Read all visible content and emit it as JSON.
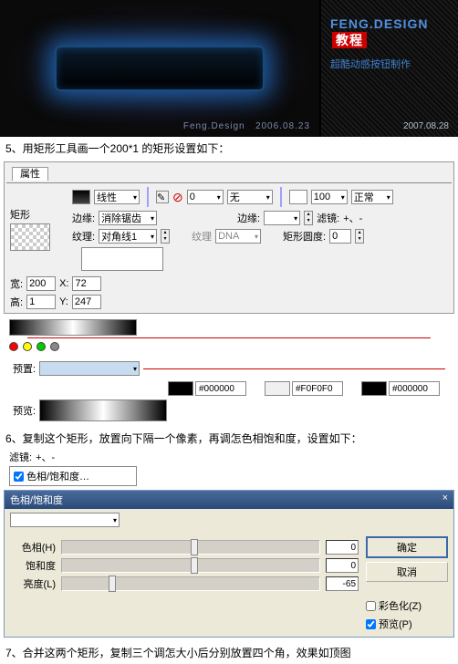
{
  "banner": {
    "logo_en": "FENG.DESIGN",
    "logo_cn": "教程",
    "subtitle": "超酷动感按钮制作",
    "footer_left": "Feng.Design",
    "date_left": "2006.08.23",
    "date_right": "2007.08.28"
  },
  "step5": "5、用矩形工具画一个200*1 的矩形设置如下：",
  "step6": "6、复制这个矩形，放置向下隔一个像素，再调怎色相饱和度，设置如下：",
  "step7": "7、合并这两个矩形，复制三个调怎大小后分别放置四个角，效果如顶图",
  "props": {
    "tab": "属性",
    "shape_lbl": "矩形",
    "stroke_type": "线性",
    "edge_lbl": "边缘:",
    "edge_val": "消除锯齿",
    "texture_lbl": "纹理:",
    "texture_val": "对角线1",
    "texture_dna": "DNA",
    "width_lbl": "宽:",
    "width_val": "200",
    "height_lbl": "高:",
    "height_val": "1",
    "x_lbl": "X:",
    "x_val": "72",
    "y_lbl": "Y:",
    "y_val": "247",
    "fill_none": "无",
    "edge2_lbl": "边缘:",
    "normal": "正常",
    "hundred": "100",
    "zero": "0",
    "filter_lbl": "滤镜:",
    "filter_plus": "+、-",
    "radius_lbl": "矩形圆度:",
    "preset_lbl": "预置:",
    "preview_lbl": "预览:",
    "texture2_lbl": "纹理"
  },
  "hexes": {
    "h1": "#000000",
    "h2": "#F0F0F0",
    "h3": "#000000"
  },
  "filter": {
    "label": "滤镜:",
    "item": "色相/饱和度…"
  },
  "hue": {
    "title": "色相/饱和度",
    "close": "×",
    "hue_lbl": "色相(H)",
    "hue_val": "0",
    "sat_lbl": "饱和度",
    "sat_val": "0",
    "light_lbl": "亮度(L)",
    "light_val": "-65",
    "ok": "确定",
    "cancel": "取消",
    "colorize": "彩色化(Z)",
    "preview": "预览(P)"
  }
}
